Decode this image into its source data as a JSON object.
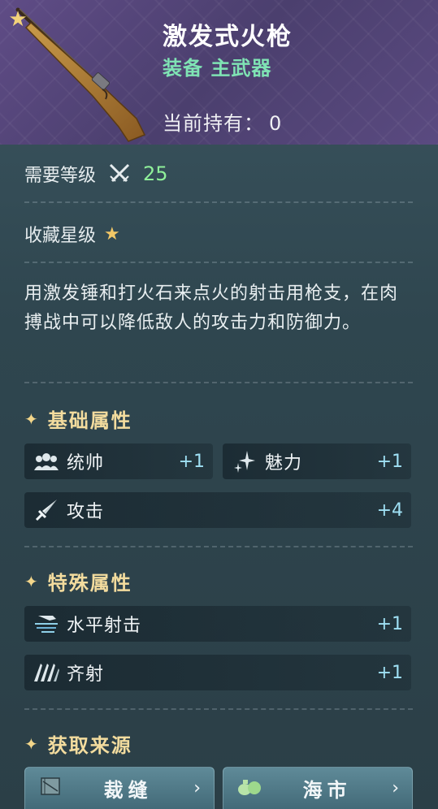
{
  "header": {
    "title": "激发式火枪",
    "type_label": "装备 主武器",
    "holding_label": "当前持有：",
    "holding_count": "0"
  },
  "level": {
    "label": "需要等级",
    "value": "25"
  },
  "collection": {
    "label": "收藏星级"
  },
  "description": "用激发锤和打火石来点火的射击用枪支，在肉搏战中可以降低敌人的攻击力和防御力。",
  "basic_attributes": {
    "title": "基础属性",
    "items": [
      {
        "label": "统帅",
        "value": "+1",
        "icon": "people-icon"
      },
      {
        "label": "魅力",
        "value": "+1",
        "icon": "sparkle-icon"
      },
      {
        "label": "攻击",
        "value": "+4",
        "icon": "sword-icon"
      }
    ]
  },
  "special_attributes": {
    "title": "特殊属性",
    "items": [
      {
        "label": "水平射击",
        "value": "+1",
        "icon": "horizontal-shot-icon"
      },
      {
        "label": "齐射",
        "value": "+1",
        "icon": "volley-icon"
      }
    ]
  },
  "sources": {
    "title": "获取来源",
    "buttons": [
      {
        "label": "裁缝",
        "icon": "tailor-icon"
      },
      {
        "label": "海市",
        "icon": "market-icon"
      }
    ]
  },
  "colors": {
    "header_bg": "#5f4c86",
    "type_green": "#7fe3b4",
    "level_green": "#8ff09a",
    "section_gold": "#f3dc9e",
    "attr_value": "#9fe0f4"
  }
}
